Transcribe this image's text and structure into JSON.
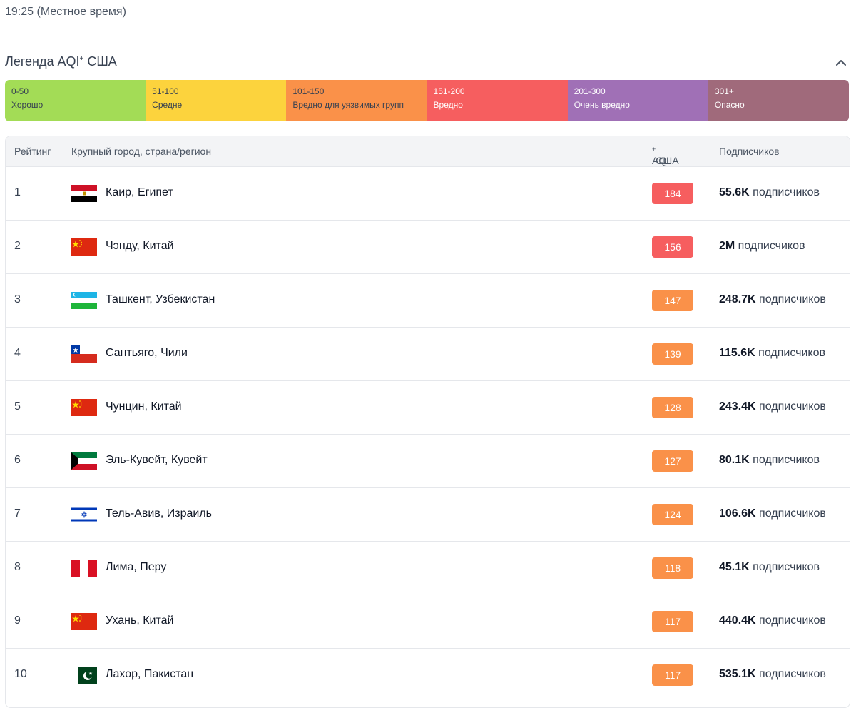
{
  "header": {
    "time": "19:25 (Местное время)"
  },
  "legend": {
    "title": "Легенда AQI",
    "title_sup": "+",
    "title_suffix": " США",
    "icon": "chevron-up-icon",
    "segments": [
      {
        "range": "0-50",
        "label": "Хорошо",
        "color": "#a3dc56",
        "text": "light"
      },
      {
        "range": "51-100",
        "label": "Средне",
        "color": "#fcd33d",
        "text": "light"
      },
      {
        "range": "101-150",
        "label": "Вредно для уязвимых групп",
        "color": "#fa9149",
        "text": "light"
      },
      {
        "range": "151-200",
        "label": "Вредно",
        "color": "#f65e5f",
        "text": "dark"
      },
      {
        "range": "201-300",
        "label": "Очень вредно",
        "color": "#a070b6",
        "text": "dark"
      },
      {
        "range": "301+",
        "label": "Опасно",
        "color": "#a06a7b",
        "text": "dark"
      }
    ]
  },
  "table": {
    "headers": {
      "rank": "Рейтинг",
      "city": "Крупный город, страна/регион",
      "aqi": "AQI",
      "aqi_sup": "+",
      "aqi_suffix": " США",
      "subscribers": "Подписчиков"
    },
    "rows": [
      {
        "rank": "1",
        "flag": "egypt-flag-icon",
        "city": "Каир, Египет",
        "aqi": "184",
        "aqi_color": "#f65e5f",
        "subs_value": "55.6K",
        "subs_suffix": " подписчиков"
      },
      {
        "rank": "2",
        "flag": "china-flag-icon",
        "city": "Чэнду, Китай",
        "aqi": "156",
        "aqi_color": "#f65e5f",
        "subs_value": "2M",
        "subs_suffix": " подписчиков"
      },
      {
        "rank": "3",
        "flag": "uzbekistan-flag-icon",
        "city": "Ташкент, Узбекистан",
        "aqi": "147",
        "aqi_color": "#fa9149",
        "subs_value": "248.7K",
        "subs_suffix": " подписчиков"
      },
      {
        "rank": "4",
        "flag": "chile-flag-icon",
        "city": "Сантьяго, Чили",
        "aqi": "139",
        "aqi_color": "#fa9149",
        "subs_value": "115.6K",
        "subs_suffix": " подписчиков"
      },
      {
        "rank": "5",
        "flag": "china-flag-icon",
        "city": "Чунцин, Китай",
        "aqi": "128",
        "aqi_color": "#fa9149",
        "subs_value": "243.4K",
        "subs_suffix": " подписчиков"
      },
      {
        "rank": "6",
        "flag": "kuwait-flag-icon",
        "city": "Эль-Кувейт, Кувейт",
        "aqi": "127",
        "aqi_color": "#fa9149",
        "subs_value": "80.1K",
        "subs_suffix": " подписчиков"
      },
      {
        "rank": "7",
        "flag": "israel-flag-icon",
        "city": "Тель-Авив, Израиль",
        "aqi": "124",
        "aqi_color": "#fa9149",
        "subs_value": "106.6K",
        "subs_suffix": " подписчиков"
      },
      {
        "rank": "8",
        "flag": "peru-flag-icon",
        "city": "Лима, Перу",
        "aqi": "118",
        "aqi_color": "#fa9149",
        "subs_value": "45.1K",
        "subs_suffix": " подписчиков"
      },
      {
        "rank": "9",
        "flag": "china-flag-icon",
        "city": "Ухань, Китай",
        "aqi": "117",
        "aqi_color": "#fa9149",
        "subs_value": "440.4K",
        "subs_suffix": " подписчиков"
      },
      {
        "rank": "10",
        "flag": "pakistan-flag-icon",
        "city": "Лахор, Пакистан",
        "aqi": "117",
        "aqi_color": "#fa9149",
        "subs_value": "535.1K",
        "subs_suffix": " подписчиков"
      }
    ]
  }
}
